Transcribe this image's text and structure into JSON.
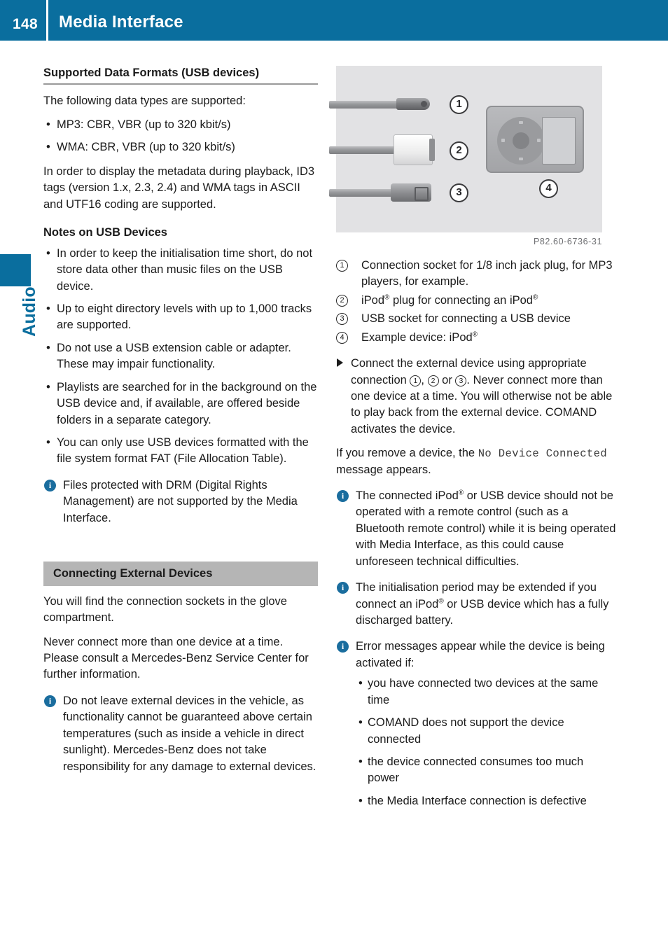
{
  "header": {
    "page_number": "148",
    "title": "Media Interface",
    "band_color": "#0a6e9e"
  },
  "chapter_tab": {
    "label": "Audio",
    "color": "#0a6e9e"
  },
  "left_column": {
    "heading_supported": "Supported Data Formats (USB devices)",
    "intro": "The following data types are supported:",
    "format_bullets": [
      "MP3: CBR, VBR (up to 320 kbit/s)",
      "WMA: CBR, VBR (up to 320 kbit/s)"
    ],
    "metadata_para": "In order to display the metadata during playback, ID3 tags (version 1.x, 2.3, 2.4) and WMA tags in ASCII and UTF16 coding are supported.",
    "heading_notes": "Notes on USB Devices",
    "usb_bullets": [
      "In order to keep the initialisation time short, do not store data other than music files on the USB device.",
      "Up to eight directory levels with up to 1,000 tracks are supported.",
      "Do not use a USB extension cable or adapter. These may impair functionality.",
      "Playlists are searched for in the background on the USB device and, if available, are offered beside folders in a separate category.",
      "You can only use USB devices formatted with the file system format FAT (File Allocation Table)."
    ],
    "note_drm": "Files protected with DRM (Digital Rights Management) are not supported by the Media Interface.",
    "heading_connecting": "Connecting External Devices",
    "connect_para1": "You will find the connection sockets in the glove compartment.",
    "connect_para2": "Never connect more than one device at a time. Please consult a Mercedes-Benz Service Center for further information.",
    "note_leave": "Do not leave external devices in the vehicle, as functionality cannot be guaranteed above certain temperatures (such as inside a vehicle in direct sunlight). Mercedes-Benz does not take responsibility for any damage to external devices."
  },
  "right_column": {
    "illustration": {
      "callouts": [
        "1",
        "2",
        "3",
        "4"
      ],
      "caption": "P82.60-6736-31"
    },
    "legend": [
      {
        "num": "1",
        "text_a": "Connection socket for 1/8 inch jack plug, for MP3 players, for example.",
        "reg": ""
      },
      {
        "num": "2",
        "text_a": "iPod",
        "text_b": " plug for connecting an iPod",
        "reg": "®"
      },
      {
        "num": "3",
        "text_a": "USB socket for connecting a USB device",
        "reg": ""
      },
      {
        "num": "4",
        "text_a": "Example device: iPod",
        "reg": "®"
      }
    ],
    "step_connect_a": "Connect the external device using appropriate connection ",
    "step_connect_b": ", ",
    "step_connect_c": " or ",
    "step_connect_d": ". Never connect more than one device at a time. You will otherwise not be able to play back from the external device. COMAND activates the device.",
    "remove_para_a": "If you remove a device, the ",
    "remove_message": "No Device Connected",
    "remove_para_b": " message appears.",
    "note_remote_a": "The connected iPod",
    "note_remote_b": " or USB device should not be operated with a remote control (such as a Bluetooth remote control) while it is being operated with Media Interface, as this could cause unforeseen technical difficulties.",
    "note_init_a": "The initialisation period may be extended if you connect an iPod",
    "note_init_b": " or USB device which has a fully discharged battery.",
    "note_errors_intro": "Error messages appear while the device is being activated if:",
    "error_bullets": [
      "you have connected two devices at the same time",
      "COMAND does not support the device connected",
      "the device connected consumes too much power",
      "the Media Interface connection is defective"
    ]
  }
}
